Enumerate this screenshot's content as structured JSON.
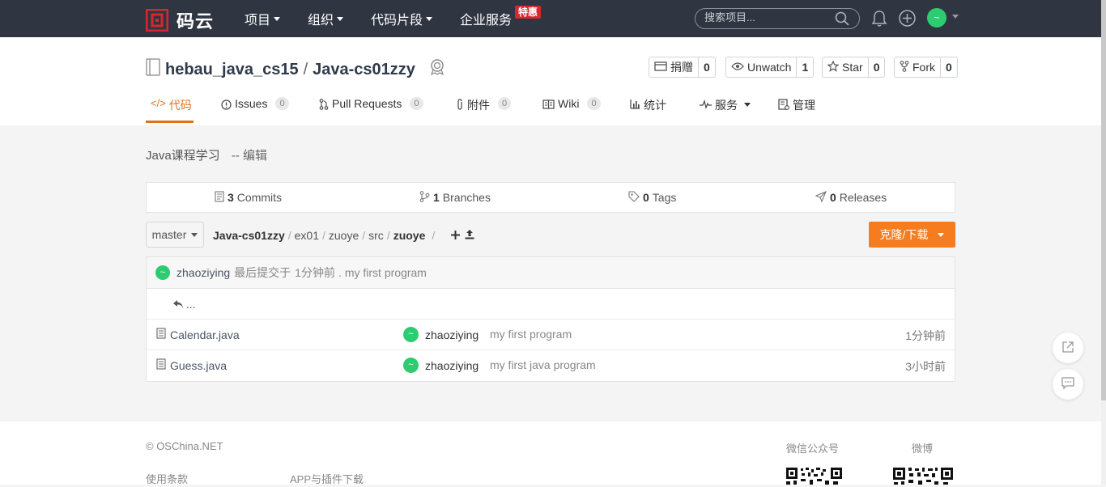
{
  "topbar": {
    "logo_text": "码云",
    "nav": [
      {
        "label": "项目"
      },
      {
        "label": "组织"
      },
      {
        "label": "代码片段"
      },
      {
        "label": "企业服务"
      }
    ],
    "special_badge": "特惠",
    "search_placeholder": "搜索项目...",
    "avatar_initial": "~"
  },
  "repo": {
    "owner": "hebau_java_cs15",
    "separator": "/",
    "name": "Java-cs01zzy",
    "buttons": [
      {
        "label": "捐赠",
        "count": "0"
      },
      {
        "label": "Unwatch",
        "count": "1"
      },
      {
        "label": "Star",
        "count": "0"
      },
      {
        "label": "Fork",
        "count": "0"
      }
    ]
  },
  "tabs": [
    {
      "label": "代码",
      "count": null,
      "active": true
    },
    {
      "label": "Issues",
      "count": "0"
    },
    {
      "label": "Pull Requests",
      "count": "0"
    },
    {
      "label": "附件",
      "count": "0"
    },
    {
      "label": "Wiki",
      "count": "0"
    },
    {
      "label": "统计",
      "count": null
    },
    {
      "label": "服务",
      "count": null
    },
    {
      "label": "管理",
      "count": null
    }
  ],
  "description": {
    "text": "Java课程学习",
    "edit_label": "-- 编辑"
  },
  "stats": [
    {
      "count": "3",
      "label": "Commits"
    },
    {
      "count": "1",
      "label": "Branches"
    },
    {
      "count": "0",
      "label": "Tags"
    },
    {
      "count": "0",
      "label": "Releases"
    }
  ],
  "branch": {
    "current": "master"
  },
  "breadcrumb": {
    "repo": "Java-cs01zzy",
    "parts": [
      "ex01",
      "zuoye",
      "src"
    ],
    "current": "zuoye",
    "trailing_sep": "/"
  },
  "clone_button": "克隆/下载",
  "last_commit": {
    "avatar": "~",
    "user": "zhaoziying",
    "text": "最后提交于",
    "time": "1分钟前",
    "dot": ".",
    "message": "my first program"
  },
  "parent_dir": "...",
  "files": [
    {
      "name": "Calendar.java",
      "avatar": "~",
      "user": "zhaoziying",
      "message": "my first program",
      "time": "1分钟前"
    },
    {
      "name": "Guess.java",
      "avatar": "~",
      "user": "zhaoziying",
      "message": "my first java program",
      "time": "3小时前"
    }
  ],
  "footer": {
    "copyright": "© OSChina.NET",
    "links": [
      "使用条款",
      "APP与插件下载"
    ],
    "wechat_label": "微信公众号",
    "weibo_label": "微博"
  },
  "colors": {
    "topbar_bg": "#2f3541",
    "accent_orange": "#f57d1f",
    "active_tab": "#e2711c",
    "avatar_green": "#2ecc71",
    "badge_red": "#d9262c"
  }
}
